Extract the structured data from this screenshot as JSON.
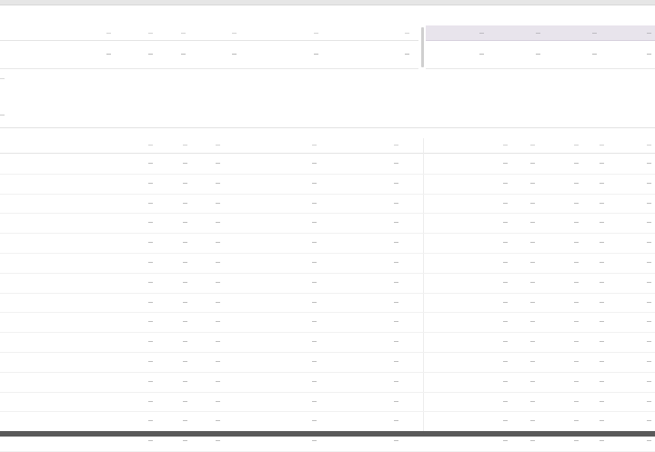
{
  "totals": {
    "headers": [
      "—",
      "—",
      "—",
      "—",
      "—",
      "—"
    ],
    "headers_highlight": [
      "—",
      "—",
      "—",
      "—"
    ],
    "values": [
      "—",
      "—",
      "—",
      "—",
      "—",
      "—"
    ],
    "values_highlight": [
      "—",
      "—",
      "—",
      "—"
    ]
  },
  "note": "—",
  "section_title": "—",
  "detail": {
    "headers": [
      "—",
      "—",
      "—",
      "—",
      "—",
      "—",
      "—",
      "—",
      "—",
      "—"
    ],
    "rows": [
      {
        "label": "",
        "cells": [
          "—",
          "—",
          "—",
          "—",
          "—",
          "—",
          "—",
          "—",
          "—",
          "—"
        ]
      },
      {
        "label": "",
        "cells": [
          "—",
          "—",
          "—",
          "—",
          "—",
          "—",
          "—",
          "—",
          "—",
          "—"
        ]
      },
      {
        "label": "",
        "cells": [
          "—",
          "—",
          "—",
          "—",
          "—",
          "—",
          "—",
          "—",
          "—",
          "—"
        ]
      },
      {
        "label": "",
        "cells": [
          "—",
          "—",
          "—",
          "—",
          "—",
          "—",
          "—",
          "—",
          "—",
          "—"
        ]
      },
      {
        "label": "",
        "cells": [
          "—",
          "—",
          "—",
          "—",
          "—",
          "—",
          "—",
          "—",
          "—",
          "—"
        ]
      },
      {
        "label": "",
        "cells": [
          "—",
          "—",
          "—",
          "—",
          "—",
          "—",
          "—",
          "—",
          "—",
          "—"
        ]
      },
      {
        "label": "",
        "cells": [
          "—",
          "—",
          "—",
          "—",
          "—",
          "—",
          "—",
          "—",
          "—",
          "—"
        ]
      },
      {
        "label": "",
        "cells": [
          "—",
          "—",
          "—",
          "—",
          "—",
          "—",
          "—",
          "—",
          "—",
          "—"
        ]
      },
      {
        "label": "",
        "cells": [
          "—",
          "—",
          "—",
          "—",
          "—",
          "—",
          "—",
          "—",
          "—",
          "—"
        ]
      },
      {
        "label": "",
        "cells": [
          "—",
          "—",
          "—",
          "—",
          "—",
          "—",
          "—",
          "—",
          "—",
          "—"
        ]
      },
      {
        "label": "",
        "cells": [
          "—",
          "—",
          "—",
          "—",
          "—",
          "—",
          "—",
          "—",
          "—",
          "—"
        ]
      },
      {
        "label": "",
        "cells": [
          "—",
          "—",
          "—",
          "—",
          "—",
          "—",
          "—",
          "—",
          "—",
          "—"
        ]
      },
      {
        "label": "",
        "cells": [
          "—",
          "—",
          "—",
          "—",
          "—",
          "—",
          "—",
          "—",
          "—",
          "—"
        ]
      },
      {
        "label": "",
        "cells": [
          "—",
          "—",
          "—",
          "—",
          "—",
          "—",
          "—",
          "—",
          "—",
          "—"
        ]
      },
      {
        "label": "",
        "cells": [
          "—",
          "—",
          "—",
          "—",
          "—",
          "—",
          "—",
          "—",
          "—",
          "—"
        ]
      }
    ]
  }
}
